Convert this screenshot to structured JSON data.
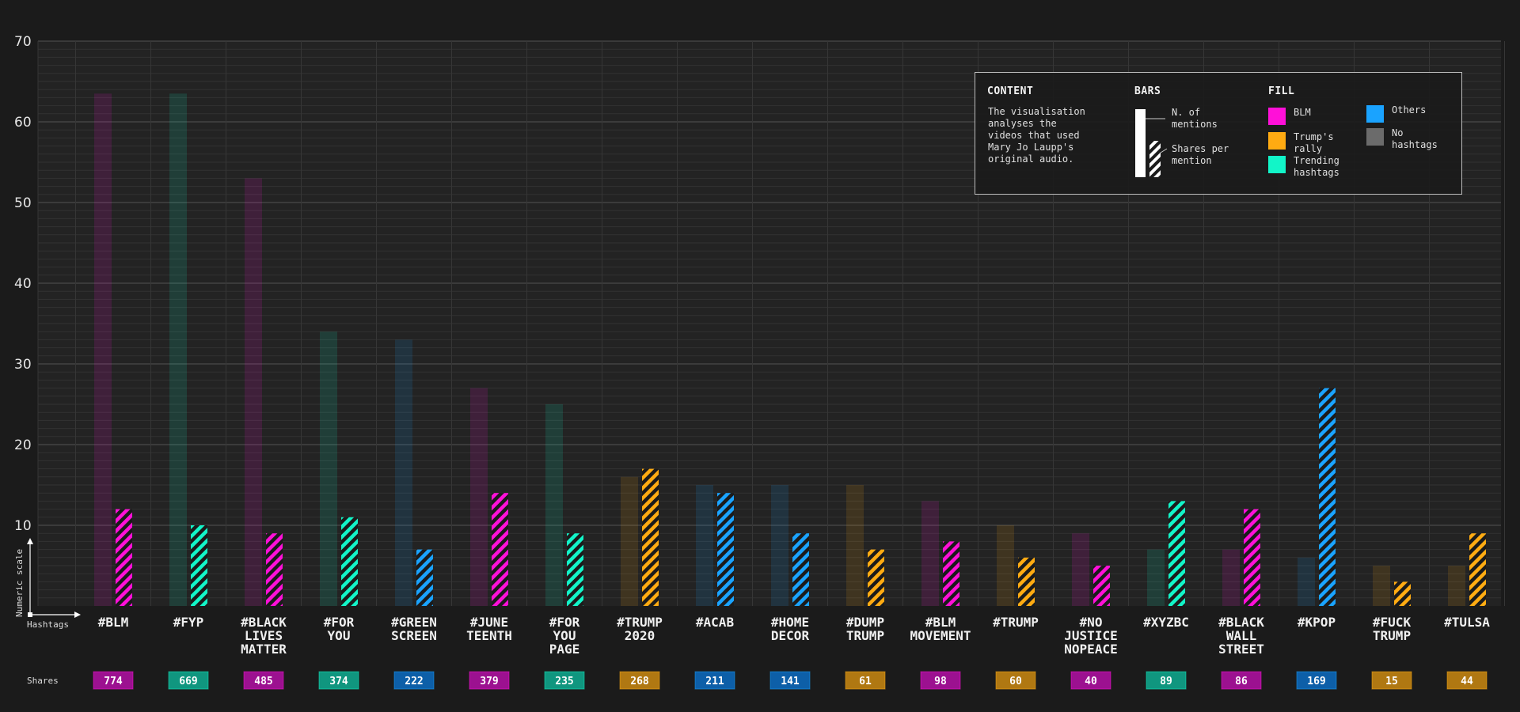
{
  "chart_data": {
    "type": "bar",
    "ylim": [
      0,
      70
    ],
    "yticks": [
      10,
      20,
      30,
      40,
      50,
      60,
      70
    ],
    "grid": true,
    "y_axis_label": "Numeric scale",
    "x_axis_label": "Hashtags",
    "shares_row_label": "Shares",
    "series": [
      {
        "name": "N. of mentions",
        "style": "solid-faded"
      },
      {
        "name": "Shares per mention",
        "style": "hatched"
      }
    ],
    "categories": [
      {
        "label": [
          "#BLM"
        ],
        "mentions": 63.5,
        "shares_per_mention": 12,
        "shares": "774",
        "group": "BLM"
      },
      {
        "label": [
          "#FYP"
        ],
        "mentions": 63.5,
        "shares_per_mention": 10,
        "shares": "669",
        "group": "Trending hashtags"
      },
      {
        "label": [
          "#BLACK",
          "LIVES",
          "MATTER"
        ],
        "mentions": 53,
        "shares_per_mention": 9,
        "shares": "485",
        "group": "BLM"
      },
      {
        "label": [
          "#FOR",
          "YOU"
        ],
        "mentions": 34,
        "shares_per_mention": 11,
        "shares": "374",
        "group": "Trending hashtags"
      },
      {
        "label": [
          "#GREEN",
          "SCREEN"
        ],
        "mentions": 33,
        "shares_per_mention": 7,
        "shares": "222",
        "group": "Others"
      },
      {
        "label": [
          "#JUNE",
          "TEENTH"
        ],
        "mentions": 27,
        "shares_per_mention": 14,
        "shares": "379",
        "group": "BLM"
      },
      {
        "label": [
          "#FOR",
          "YOU",
          "PAGE"
        ],
        "mentions": 25,
        "shares_per_mention": 9,
        "shares": "235",
        "group": "Trending hashtags"
      },
      {
        "label": [
          "#TRUMP",
          "2020"
        ],
        "mentions": 16,
        "shares_per_mention": 17,
        "shares": "268",
        "group": "Trump's rally"
      },
      {
        "label": [
          "#ACAB"
        ],
        "mentions": 15,
        "shares_per_mention": 14,
        "shares": "211",
        "group": "Others"
      },
      {
        "label": [
          "#HOME",
          "DECOR"
        ],
        "mentions": 15,
        "shares_per_mention": 9,
        "shares": "141",
        "group": "Others"
      },
      {
        "label": [
          "#DUMP",
          "TRUMP"
        ],
        "mentions": 15,
        "shares_per_mention": 7,
        "shares": "61",
        "group": "Trump's rally"
      },
      {
        "label": [
          "#BLM",
          "MOVEMENT"
        ],
        "mentions": 13,
        "shares_per_mention": 8,
        "shares": "98",
        "group": "BLM"
      },
      {
        "label": [
          "#TRUMP"
        ],
        "mentions": 10,
        "shares_per_mention": 6,
        "shares": "60",
        "group": "Trump's rally"
      },
      {
        "label": [
          "#NO",
          "JUSTICE",
          "NOPEACE"
        ],
        "mentions": 9,
        "shares_per_mention": 5,
        "shares": "40",
        "group": "BLM"
      },
      {
        "label": [
          "#XYZBC"
        ],
        "mentions": 7,
        "shares_per_mention": 13,
        "shares": "89",
        "group": "Trending hashtags"
      },
      {
        "label": [
          "#BLACK",
          "WALL",
          "STREET"
        ],
        "mentions": 7,
        "shares_per_mention": 12,
        "shares": "86",
        "group": "BLM"
      },
      {
        "label": [
          "#KPOP"
        ],
        "mentions": 6,
        "shares_per_mention": 27,
        "shares": "169",
        "group": "Others"
      },
      {
        "label": [
          "#FUCK",
          "TRUMP"
        ],
        "mentions": 5,
        "shares_per_mention": 3,
        "shares": "15",
        "group": "Trump's rally"
      },
      {
        "label": [
          "#TULSA"
        ],
        "mentions": 5,
        "shares_per_mention": 9,
        "shares": "44",
        "group": "Trump's rally"
      }
    ]
  },
  "colors": {
    "background": "#1b1b1b",
    "BLM": "#ff10d8",
    "Trump's rally": "#ffab12",
    "Trending hashtags": "#12f5c8",
    "Others": "#1aa3ff",
    "No hashtags": "#6b6b6b",
    "BLM_badge": "#9c1190",
    "Trump's rally_badge": "#b07812",
    "Trending hashtags_badge": "#10967f",
    "Others_badge": "#0d5fa8"
  },
  "legend": {
    "content_title": "CONTENT",
    "content_text": "The visualisation\nanalyses the\nvideos that used\nMary Jo Laupp's\noriginal audio.",
    "bars_title": "BARS",
    "bars_solid_label": "N. of\nmentions",
    "bars_hatched_label": "Shares per\nmention",
    "fill_title": "FILL",
    "fill_items": [
      {
        "key": "BLM",
        "label": "BLM"
      },
      {
        "key": "Trump's rally",
        "label": "Trump's\nrally"
      },
      {
        "key": "Trending hashtags",
        "label": "Trending\nhashtags"
      },
      {
        "key": "Others",
        "label": "Others"
      },
      {
        "key": "No hashtags",
        "label": "No\nhashtags"
      }
    ]
  }
}
